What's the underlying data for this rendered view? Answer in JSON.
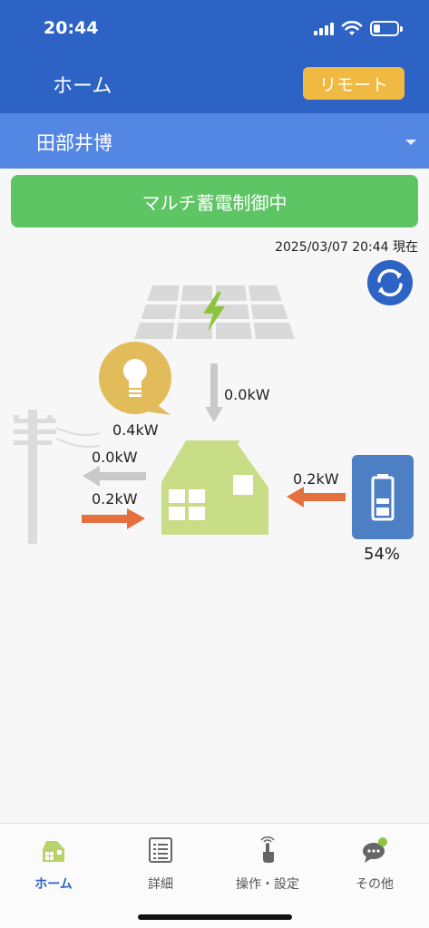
{
  "status_bar": {
    "time": "20:44"
  },
  "header": {
    "title": "ホーム",
    "remote_label": "リモート"
  },
  "site": {
    "name": "田部井博"
  },
  "status": {
    "mode": "マルチ蓄電制御中",
    "timestamp": "2025/03/07 20:44 現在"
  },
  "flows": {
    "solar_to_house": "0.0kW",
    "consumption": "0.4kW",
    "house_to_grid": "0.0kW",
    "grid_to_house": "0.2kW",
    "battery_to_house": "0.2kW",
    "battery_level": "54%"
  },
  "colors": {
    "header": "#2c63c4",
    "site_bar": "#5487e4",
    "mode_banner": "#5ec565",
    "remote": "#f0b941",
    "house": "#c8dd86",
    "battery": "#4d7fc5",
    "arrow_active": "#e56f3d",
    "arrow_idle": "#c9c9c9"
  },
  "tabs": [
    {
      "label": "ホーム",
      "icon": "home-icon",
      "active": true
    },
    {
      "label": "詳細",
      "icon": "list-icon",
      "active": false
    },
    {
      "label": "操作・設定",
      "icon": "touch-icon",
      "active": false
    },
    {
      "label": "その他",
      "icon": "chat-icon",
      "active": false
    }
  ]
}
